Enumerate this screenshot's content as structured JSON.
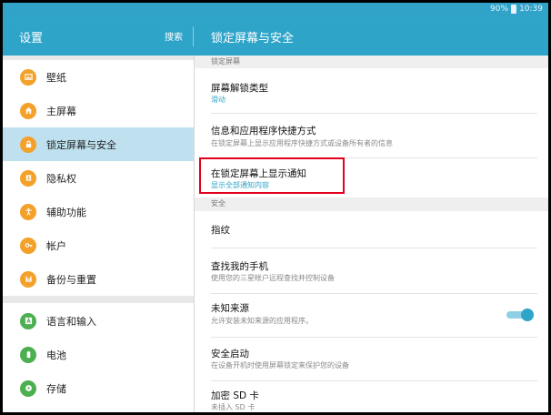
{
  "status_bar": {
    "battery": "90%",
    "time": "10:39"
  },
  "app_bar": {
    "title": "设置",
    "search_label": "搜索",
    "page_title": "锁定屏幕与安全"
  },
  "sidebar": {
    "items": [
      {
        "label": "壁纸",
        "icon": "wallpaper-icon",
        "selected": false
      },
      {
        "label": "主屏幕",
        "icon": "home-icon",
        "selected": false
      },
      {
        "label": "锁定屏幕与安全",
        "icon": "lock-icon",
        "selected": true
      },
      {
        "label": "隐私权",
        "icon": "privacy-icon",
        "selected": false
      },
      {
        "label": "辅助功能",
        "icon": "accessibility-icon",
        "selected": false
      },
      {
        "label": "帐户",
        "icon": "key-icon",
        "selected": false
      },
      {
        "label": "备份与重置",
        "icon": "backup-icon",
        "selected": false
      },
      {
        "label": "语言和输入",
        "icon": "language-icon",
        "selected": false
      },
      {
        "label": "电池",
        "icon": "battery-icon",
        "selected": false
      },
      {
        "label": "存储",
        "icon": "storage-icon",
        "selected": false
      }
    ]
  },
  "main": {
    "section_lock": "锁定屏幕",
    "section_security": "安全",
    "rows": [
      {
        "title": "屏幕解锁类型",
        "subtitle": "滑动"
      },
      {
        "title": "信息和应用程序快捷方式",
        "subtitle": "在锁定屏幕上显示应用程序快捷方式或设备所有者的信息"
      },
      {
        "title": "在锁定屏幕上显示通知",
        "subtitle": "显示全部通知内容"
      },
      {
        "title": "指纹",
        "subtitle": ""
      },
      {
        "title": "查找我的手机",
        "subtitle": "使用您的三星帐户远程查找并控制设备"
      },
      {
        "title": "未知来源",
        "subtitle": "允许安装未知来源的应用程序。",
        "toggle_on": true
      },
      {
        "title": "安全启动",
        "subtitle": "在设备开机时使用屏幕锁定来保护您的设备"
      },
      {
        "title": "加密 SD 卡",
        "subtitle": "未插入 SD 卡"
      }
    ]
  },
  "colors": {
    "accent": "#2fa4c9",
    "selected_bg": "#bfe1ef",
    "highlight": "#e3001b",
    "icon_orange": "#f3a12b",
    "icon_green": "#4caf50"
  }
}
